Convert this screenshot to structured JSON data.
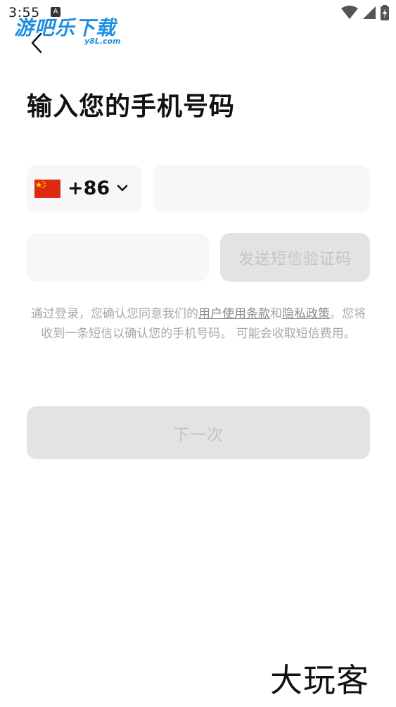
{
  "status_bar": {
    "time": "3:55",
    "notification_letter": "A",
    "icons": [
      "wifi-icon",
      "signal-icon",
      "battery-charging-icon"
    ]
  },
  "watermark_top": {
    "text": "游吧乐下载",
    "subtext": "y8L.com"
  },
  "header": {
    "back_icon": "chevron-left-icon"
  },
  "page_title": "输入您的手机号码",
  "phone_form": {
    "country_flag": "china-flag-icon",
    "country_code": "+86",
    "dropdown_icon": "chevron-down-icon",
    "phone_value": "",
    "phone_placeholder": "",
    "code_value": "",
    "code_placeholder": "",
    "send_code_label": "发送短信验证码"
  },
  "terms": {
    "prefix": "通过登录，您确认您同意我们的",
    "user_terms_link": "用户使用条款",
    "and": "和",
    "privacy_link": "隐私政策",
    "suffix": "。您将收到一条短信以确认您的手机号码。 可能会收取短信费用。"
  },
  "next_button_label": "下一次",
  "watermark_bottom": "大玩客",
  "colors": {
    "input_bg": "#f7f7f7",
    "disabled_button_bg": "#e3e3e3",
    "disabled_text": "#c4c4c4",
    "watermark_blue": "#1e8fe0"
  }
}
